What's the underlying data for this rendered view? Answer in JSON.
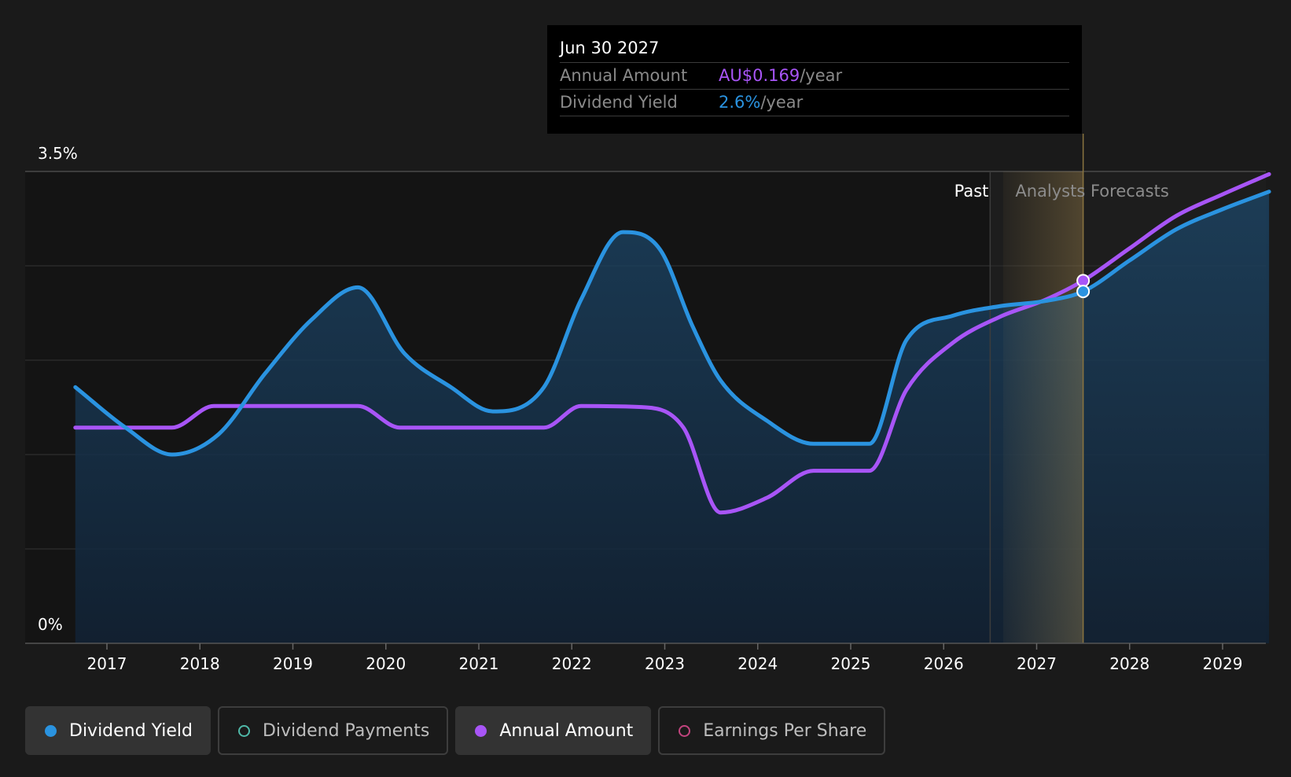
{
  "chart_data": {
    "type": "line",
    "y_axis": {
      "top_label": "3.5%",
      "bottom_label": "0%",
      "ylim": [
        0,
        3.5
      ]
    },
    "x_ticks": [
      "2017",
      "2018",
      "2019",
      "2020",
      "2021",
      "2022",
      "2023",
      "2024",
      "2025",
      "2026",
      "2027",
      "2028",
      "2029"
    ],
    "xlim": [
      2016.66,
      2029.5
    ],
    "grid": true,
    "past_label": "Past",
    "forecast_label": "Analysts Forecasts",
    "forecast_start": 2026.5,
    "highlight": {
      "start": 2026.64,
      "end": 2027.5
    },
    "series": [
      {
        "name": "Dividend Yield",
        "color": "#2a93e0",
        "filled": true,
        "points": [
          [
            2016.66,
            1.9
          ],
          [
            2017.2,
            1.6
          ],
          [
            2017.7,
            1.4
          ],
          [
            2018.2,
            1.55
          ],
          [
            2018.7,
            2.0
          ],
          [
            2019.2,
            2.4
          ],
          [
            2019.7,
            2.64
          ],
          [
            2020.2,
            2.15
          ],
          [
            2020.7,
            1.9
          ],
          [
            2021.15,
            1.72
          ],
          [
            2021.7,
            1.9
          ],
          [
            2022.1,
            2.55
          ],
          [
            2022.55,
            3.05
          ],
          [
            2022.95,
            2.92
          ],
          [
            2023.3,
            2.35
          ],
          [
            2023.6,
            1.95
          ],
          [
            2024.1,
            1.65
          ],
          [
            2024.6,
            1.48
          ],
          [
            2025.2,
            1.48
          ],
          [
            2025.6,
            2.25
          ],
          [
            2026.1,
            2.43
          ],
          [
            2026.6,
            2.5
          ],
          [
            2027.1,
            2.54
          ],
          [
            2027.5,
            2.61
          ],
          [
            2028.0,
            2.84
          ],
          [
            2028.5,
            3.07
          ],
          [
            2029.0,
            3.22
          ],
          [
            2029.5,
            3.35
          ]
        ]
      },
      {
        "name": "Annual Amount",
        "color": "#a855f7",
        "filled": false,
        "points": [
          [
            2016.66,
            1.6
          ],
          [
            2017.7,
            1.6
          ],
          [
            2018.15,
            1.76
          ],
          [
            2019.7,
            1.76
          ],
          [
            2020.15,
            1.6
          ],
          [
            2021.7,
            1.6
          ],
          [
            2022.1,
            1.76
          ],
          [
            2022.8,
            1.75
          ],
          [
            2023.2,
            1.6
          ],
          [
            2023.6,
            0.97
          ],
          [
            2024.1,
            1.08
          ],
          [
            2024.6,
            1.28
          ],
          [
            2025.2,
            1.28
          ],
          [
            2025.6,
            1.88
          ],
          [
            2026.1,
            2.23
          ],
          [
            2026.6,
            2.42
          ],
          [
            2027.1,
            2.55
          ],
          [
            2027.5,
            2.69
          ],
          [
            2028.0,
            2.93
          ],
          [
            2028.5,
            3.17
          ],
          [
            2029.0,
            3.33
          ],
          [
            2029.5,
            3.48
          ]
        ]
      }
    ],
    "markers": [
      {
        "series": "Annual Amount",
        "x": 2027.5,
        "y": 2.69
      },
      {
        "series": "Dividend Yield",
        "x": 2027.5,
        "y": 2.61
      }
    ]
  },
  "tooltip": {
    "date": "Jun 30 2027",
    "rows": [
      {
        "label": "Annual Amount",
        "value": "AU$0.169",
        "unit": "/year"
      },
      {
        "label": "Dividend Yield",
        "value": "2.6%",
        "unit": "/year"
      }
    ]
  },
  "legend": [
    {
      "label": "Dividend Yield",
      "color": "#2a93e0",
      "active": true,
      "hollow": false
    },
    {
      "label": "Dividend Payments",
      "color": "#4fb8a8",
      "active": false,
      "hollow": true
    },
    {
      "label": "Annual Amount",
      "color": "#a855f7",
      "active": true,
      "hollow": false
    },
    {
      "label": "Earnings Per Share",
      "color": "#c2447e",
      "active": false,
      "hollow": true
    }
  ]
}
